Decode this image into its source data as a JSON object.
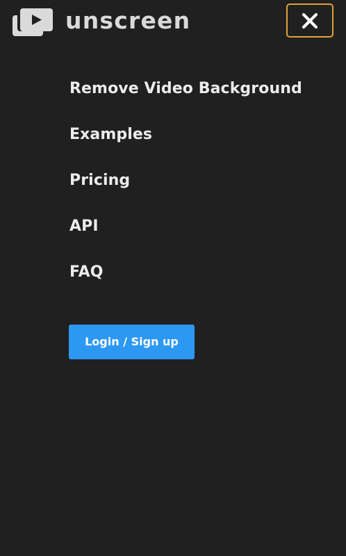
{
  "brand": {
    "name": "unscreen",
    "icon": "stacked-video-play-icon"
  },
  "header": {
    "close_icon": "close-icon"
  },
  "nav": {
    "items": [
      {
        "label": "Remove Video Background"
      },
      {
        "label": "Examples"
      },
      {
        "label": "Pricing"
      },
      {
        "label": "API"
      },
      {
        "label": "FAQ"
      }
    ]
  },
  "auth": {
    "login_label": "Login / Sign up"
  },
  "colors": {
    "background": "#202020",
    "text": "#ececec",
    "logo_text": "#dadada",
    "focus_outline": "#e3a23a",
    "primary_button": "#2d98f3"
  }
}
